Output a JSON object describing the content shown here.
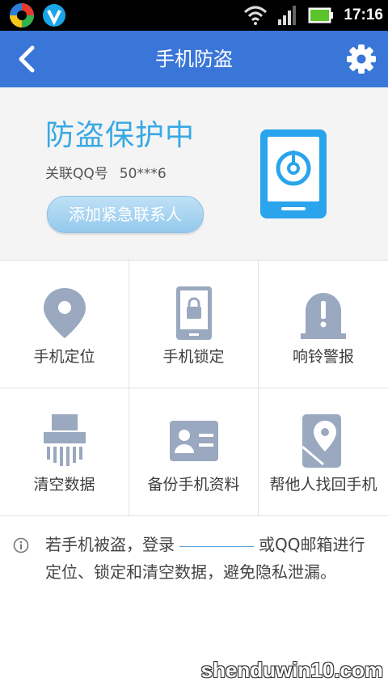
{
  "status_bar": {
    "time": "17:16",
    "icons": [
      "app-swirl-icon",
      "shield-v-icon",
      "wifi-icon",
      "signal-icon",
      "battery-icon"
    ]
  },
  "title_bar": {
    "title": "手机防盗",
    "back_icon": "back-arrow-icon",
    "settings_icon": "gear-icon"
  },
  "status_card": {
    "headline": "防盗保护中",
    "qq_label": "关联QQ号",
    "qq_value": "50***6",
    "add_contact_label": "添加紧急联系人",
    "graphic": "phone-lock-icon"
  },
  "grid": {
    "items": [
      {
        "label": "手机定位",
        "icon": "location-pin-icon"
      },
      {
        "label": "手机锁定",
        "icon": "phone-lock-icon"
      },
      {
        "label": "响铃警报",
        "icon": "alarm-bell-icon"
      },
      {
        "label": "清空数据",
        "icon": "shredder-icon"
      },
      {
        "label": "备份手机资料",
        "icon": "contact-card-icon"
      },
      {
        "label": "帮他人找回手机",
        "icon": "phone-location-icon"
      }
    ]
  },
  "note": {
    "text_before": "若手机被盗，登录",
    "text_after": "或QQ邮箱进行定位、锁定和清空数据，避免隐私泄漏。"
  },
  "watermark": "shenduwin10.com",
  "colors": {
    "title_bar": "#3a76d8",
    "headline": "#38a8e4",
    "icon_gray": "#9aa8c0",
    "card_bg": "#f4f4f4"
  }
}
